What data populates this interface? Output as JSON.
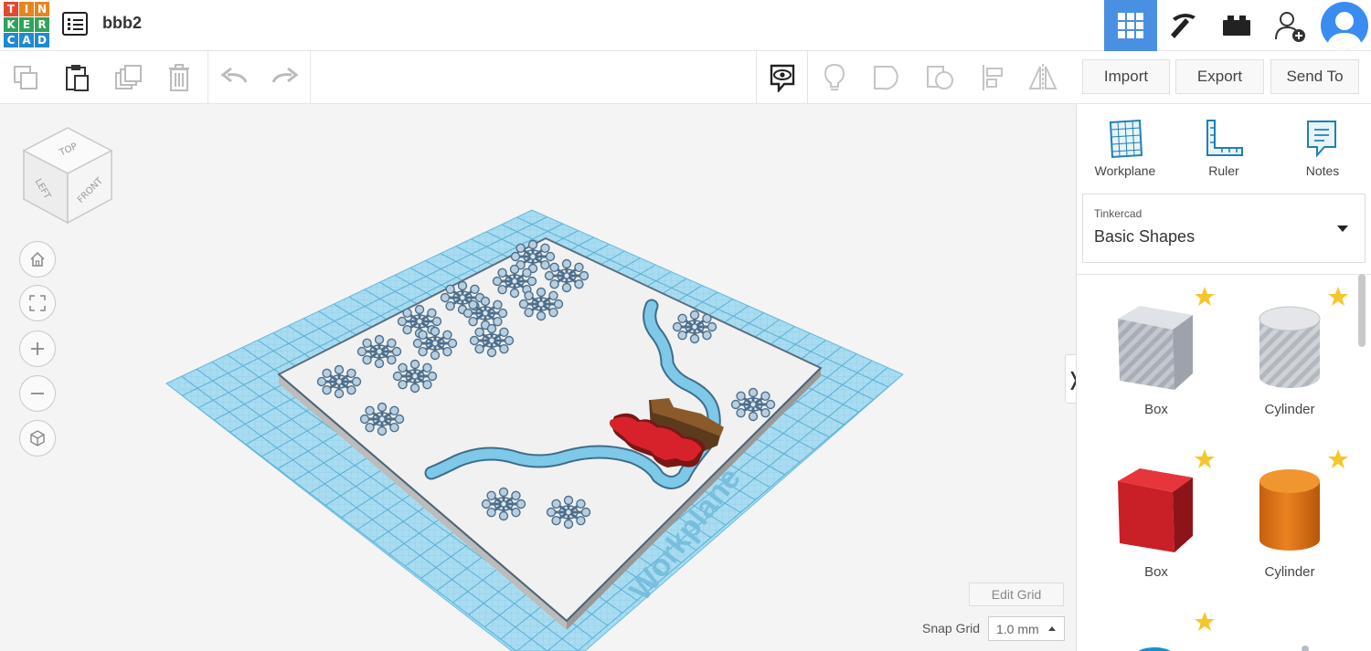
{
  "app": {
    "logo_letters": [
      "T",
      "I",
      "N",
      "K",
      "E",
      "R",
      "C",
      "A",
      "D"
    ],
    "logo_colors": [
      "#e24a2f",
      "#e8841f",
      "#e8841f",
      "#2ea35a",
      "#2ea35a",
      "#2ea35a",
      "#1f8ad0",
      "#1f8ad0",
      "#1f8ad0"
    ],
    "design_title": "bbb2",
    "accent": "#4a90e2"
  },
  "top_nav": {
    "items": [
      "grid-icon",
      "pickaxe-icon",
      "brick-icon",
      "add-user-icon",
      "avatar"
    ]
  },
  "actions": {
    "import_label": "Import",
    "export_label": "Export",
    "send_to_label": "Send To"
  },
  "viewport": {
    "view_cube": {
      "top": "TOP",
      "left": "LEFT",
      "front": "FRONT"
    },
    "workplane_watermark": "Workplane",
    "edit_grid_label": "Edit Grid",
    "snap_grid_label": "Snap Grid",
    "snap_grid_value": "1.0 mm",
    "collapse_glyph": "❭"
  },
  "panel": {
    "tools": [
      {
        "label": "Workplane",
        "icon": "workplane-icon"
      },
      {
        "label": "Ruler",
        "icon": "ruler-icon"
      },
      {
        "label": "Notes",
        "icon": "notes-icon"
      }
    ],
    "library": {
      "category": "Tinkercad",
      "name": "Basic Shapes"
    },
    "shapes": [
      {
        "label": "Box",
        "style": "striped",
        "color": "#bfc4cb"
      },
      {
        "label": "Cylinder",
        "style": "striped",
        "color": "#c8ccd2"
      },
      {
        "label": "Box",
        "style": "solid",
        "color": "#d42a2f"
      },
      {
        "label": "Cylinder",
        "style": "solid",
        "color": "#e77a17"
      }
    ]
  }
}
